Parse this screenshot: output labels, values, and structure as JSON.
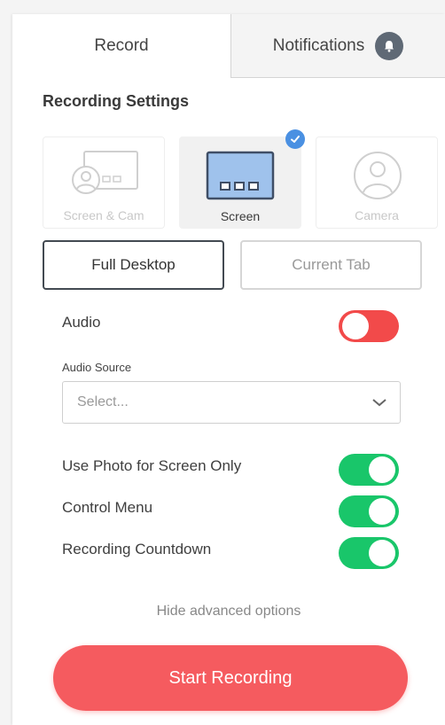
{
  "tabs": {
    "record": "Record",
    "notifications": "Notifications"
  },
  "section_title": "Recording Settings",
  "modes": [
    {
      "label": "Screen & Cam",
      "state": "disabled"
    },
    {
      "label": "Screen",
      "state": "selected"
    },
    {
      "label": "Camera",
      "state": "disabled"
    }
  ],
  "capture": {
    "full_desktop": "Full Desktop",
    "current_tab": "Current Tab",
    "selected": "Full Desktop"
  },
  "audio": {
    "label": "Audio",
    "enabled": false
  },
  "audio_source": {
    "label": "Audio Source",
    "value": "Select..."
  },
  "options": [
    {
      "label": "Use Photo for Screen Only",
      "enabled": true
    },
    {
      "label": "Control Menu",
      "enabled": true
    },
    {
      "label": "Recording Countdown",
      "enabled": true
    }
  ],
  "hide_advanced": "Hide advanced options",
  "start_button": "Start Recording",
  "colors": {
    "accent_red": "#f55b5f",
    "toggle_on": "#19c66a",
    "toggle_off": "#f24a4a",
    "selected_blue": "#4a90e2"
  },
  "icons": {
    "notifications": "bell-icon",
    "selected": "checkmark-icon",
    "dropdown": "chevron-down-icon"
  }
}
